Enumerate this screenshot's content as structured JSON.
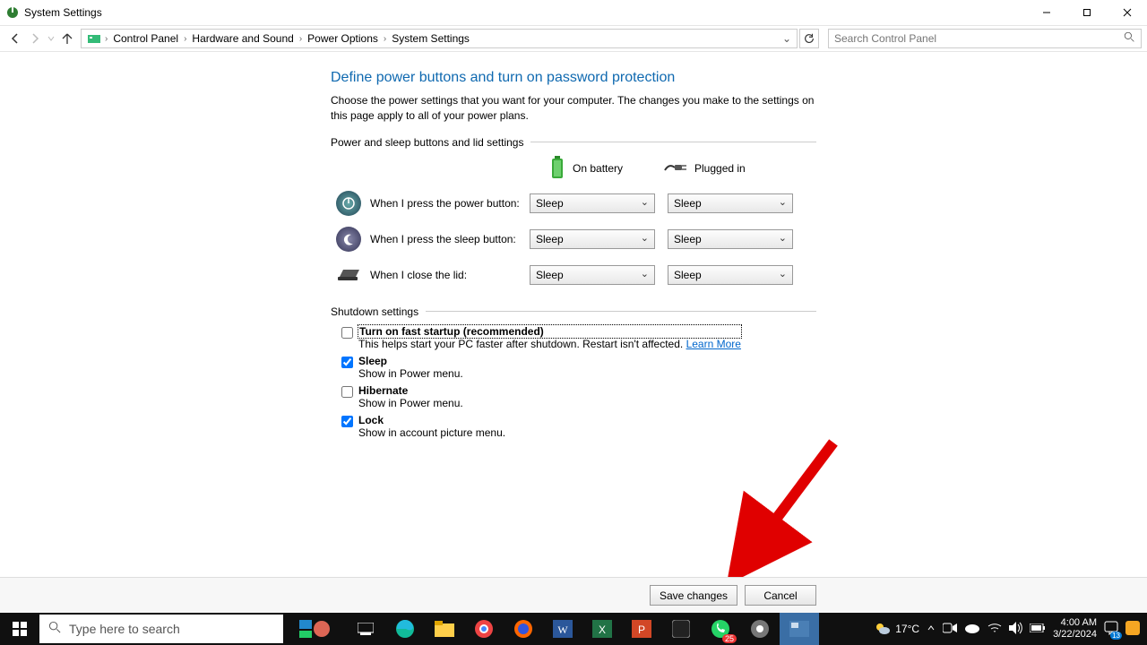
{
  "window": {
    "title": "System Settings"
  },
  "breadcrumb": {
    "items": [
      "Control Panel",
      "Hardware and Sound",
      "Power Options",
      "System Settings"
    ]
  },
  "search": {
    "placeholder": "Search Control Panel"
  },
  "page": {
    "heading": "Define power buttons and turn on password protection",
    "desc": "Choose the power settings that you want for your computer. The changes you make to the settings on this page apply to all of your power plans."
  },
  "group1": {
    "legend": "Power and sleep buttons and lid settings",
    "col1": "On battery",
    "col2": "Plugged in",
    "rows": [
      {
        "label": "When I press the power button:",
        "batt": "Sleep",
        "plug": "Sleep"
      },
      {
        "label": "When I press the sleep button:",
        "batt": "Sleep",
        "plug": "Sleep"
      },
      {
        "label": "When I close the lid:",
        "batt": "Sleep",
        "plug": "Sleep"
      }
    ]
  },
  "group2": {
    "legend": "Shutdown settings",
    "items": [
      {
        "label": "Turn on fast startup (recommended)",
        "desc": "This helps start your PC faster after shutdown. Restart isn't affected. ",
        "link": "Learn More",
        "checked": false,
        "boxed": true
      },
      {
        "label": "Sleep",
        "desc": "Show in Power menu.",
        "checked": true
      },
      {
        "label": "Hibernate",
        "desc": "Show in Power menu.",
        "checked": false
      },
      {
        "label": "Lock",
        "desc": "Show in account picture menu.",
        "checked": true
      }
    ]
  },
  "buttons": {
    "save": "Save changes",
    "cancel": "Cancel"
  },
  "taskbar": {
    "search_placeholder": "Type here to search",
    "weather": "17°C",
    "time": "4:00 AM",
    "date": "3/22/2024",
    "notif_count": "13"
  }
}
